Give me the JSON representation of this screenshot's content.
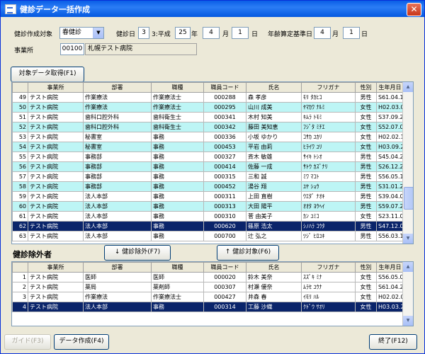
{
  "window": {
    "title": "健診データ一括作成",
    "close_label": "✕"
  },
  "form": {
    "target_label": "健診作成対象",
    "target_value": "春健診",
    "exam_date_label": "健診日",
    "exam_date": {
      "era_no": "3",
      "era_name": "3:平成",
      "year": "25",
      "year_label": "年",
      "month": "4",
      "month_label": "月",
      "day": "1",
      "day_label": "日"
    },
    "age_base_label": "年齢算定基準日",
    "age_base": {
      "month": "4",
      "month_label": "月",
      "day": "1",
      "day_label": "日"
    },
    "office_label": "事業所",
    "office_code": "00100",
    "office_name": "札幌テスト病院"
  },
  "buttons": {
    "fetch": "対象データ取得(F1)",
    "exclude": "↓ 健診除外(F7)",
    "include": "↑ 健診対象(F6)",
    "guide": "ガイド(F3)",
    "create": "データ作成(F4)",
    "exit": "終了(F12)"
  },
  "columns": [
    "",
    "事業所",
    "部署",
    "職種",
    "職員コード",
    "氏名",
    "フリガナ",
    "性別",
    "生年月日"
  ],
  "target_rows": [
    {
      "no": "49",
      "office": "テスト病院",
      "dept": "作業療法",
      "job": "作業療法士",
      "code": "000288",
      "name": "森 孝彦",
      "kana": "ﾓﾘ ﾀｶﾋｺ",
      "sex": "男性",
      "dob": "S61.04.17",
      "style": ""
    },
    {
      "no": "50",
      "office": "テスト病院",
      "dept": "作業療法",
      "job": "作業療法士",
      "code": "000295",
      "name": "山川 成美",
      "kana": "ﾔﾏｶﾜ ﾅﾙﾐ",
      "sex": "女性",
      "dob": "H02.03.02",
      "style": "cyan"
    },
    {
      "no": "51",
      "office": "テスト病院",
      "dept": "歯科口腔外科",
      "job": "歯科衛生士",
      "code": "000341",
      "name": "木村 知美",
      "kana": "ｷﾑﾗ ﾄﾓﾐ",
      "sex": "女性",
      "dob": "S37.09.22",
      "style": ""
    },
    {
      "no": "52",
      "office": "テスト病院",
      "dept": "歯科口腔外科",
      "job": "歯科衛生士",
      "code": "000342",
      "name": "藤田 美知恵",
      "kana": "ﾌｼﾞﾀ ﾐﾁｴ",
      "sex": "女性",
      "dob": "S52.07.01",
      "style": "cyan"
    },
    {
      "no": "53",
      "office": "テスト病院",
      "dept": "秘書室",
      "job": "事務",
      "code": "000336",
      "name": "小坂 ゆかり",
      "kana": "ｺｻｶ ﾕｶﾘ",
      "sex": "女性",
      "dob": "H02.02.15",
      "style": ""
    },
    {
      "no": "54",
      "office": "テスト病院",
      "dept": "秘書室",
      "job": "事務",
      "code": "000453",
      "name": "平岩 由莉",
      "kana": "ﾋﾗｲﾜ ﾕﾘ",
      "sex": "女性",
      "dob": "H03.09.26",
      "style": "cyan"
    },
    {
      "no": "55",
      "office": "テスト病院",
      "dept": "事務部",
      "job": "事務",
      "code": "000327",
      "name": "斉木 敏雄",
      "kana": "ｻｲｷ ﾄｼｵ",
      "sex": "男性",
      "dob": "S45.04.28",
      "style": ""
    },
    {
      "no": "56",
      "office": "テスト病院",
      "dept": "事務部",
      "job": "事務",
      "code": "000414",
      "name": "佐藤 一成",
      "kana": "ｻﾄｳ ｶｽﾞﾅﾘ",
      "sex": "男性",
      "dob": "S26.12.23",
      "style": "cyan"
    },
    {
      "no": "57",
      "office": "テスト病院",
      "dept": "事務部",
      "job": "事務",
      "code": "000315",
      "name": "三和 誠",
      "kana": "ﾐﾜ ﾏｺﾄ",
      "sex": "男性",
      "dob": "S56.05.14",
      "style": ""
    },
    {
      "no": "58",
      "office": "テスト病院",
      "dept": "事務部",
      "job": "事務",
      "code": "000452",
      "name": "湯谷 翔",
      "kana": "ﾕﾔ ｼｮｳ",
      "sex": "男性",
      "dob": "S31.01.29",
      "style": "cyan"
    },
    {
      "no": "59",
      "office": "テスト病院",
      "dept": "法人本部",
      "job": "事務",
      "code": "000311",
      "name": "上田 直樹",
      "kana": "ｳｴﾀﾞ ﾅｵｷ",
      "sex": "男性",
      "dob": "S39.04.08",
      "style": ""
    },
    {
      "no": "60",
      "office": "テスト病院",
      "dept": "法人本部",
      "job": "事務",
      "code": "000313",
      "name": "大田 陽平",
      "kana": "ｵｵﾀ ﾖｳﾍｲ",
      "sex": "男性",
      "dob": "S59.07.23",
      "style": "cyan"
    },
    {
      "no": "61",
      "office": "テスト病院",
      "dept": "法人本部",
      "job": "事務",
      "code": "000310",
      "name": "菅 由美子",
      "kana": "ｶﾝ ﾕﾐｺ",
      "sex": "女性",
      "dob": "S23.11.07",
      "style": ""
    },
    {
      "no": "62",
      "office": "テスト病院",
      "dept": "法人本部",
      "job": "事務",
      "code": "000620",
      "name": "篠原 浩太",
      "kana": "ｼﾉﾊﾗ ｺｳﾀ",
      "sex": "男性",
      "dob": "S47.12.01",
      "style": "sel"
    },
    {
      "no": "63",
      "office": "テスト病院",
      "dept": "法人本部",
      "job": "事務",
      "code": "000700",
      "name": "辻 弘之",
      "kana": "ﾂｼﾞ ﾋﾛﾕｷ",
      "sex": "男性",
      "dob": "S56.03.10",
      "style": ""
    }
  ],
  "excluded_title": "健診除外者",
  "excluded_rows": [
    {
      "no": "1",
      "office": "テスト病院",
      "dept": "医師",
      "job": "医師",
      "code": "000020",
      "name": "鈴木 美奈",
      "kana": "ｽｽﾞｷ ﾐﾅ",
      "sex": "女性",
      "dob": "S56.05.09",
      "style": ""
    },
    {
      "no": "2",
      "office": "テスト病院",
      "dept": "薬局",
      "job": "薬剤師",
      "code": "000307",
      "name": "村瀬 優奈",
      "kana": "ﾑﾗｾ ﾕｳﾅ",
      "sex": "女性",
      "dob": "S61.04.26",
      "style": ""
    },
    {
      "no": "3",
      "office": "テスト病院",
      "dept": "作業療法",
      "job": "作業療法士",
      "code": "000427",
      "name": "井森 春",
      "kana": "ｲﾓﾘ ﾊﾙ",
      "sex": "女性",
      "dob": "H02.02.09",
      "style": ""
    },
    {
      "no": "4",
      "office": "テスト病院",
      "dept": "法人本部",
      "job": "事務",
      "code": "000314",
      "name": "工藤 沙織",
      "kana": "ｸﾄﾞｳ ｻｵﾘ",
      "sex": "女性",
      "dob": "H03.03.24",
      "style": "sel"
    }
  ]
}
